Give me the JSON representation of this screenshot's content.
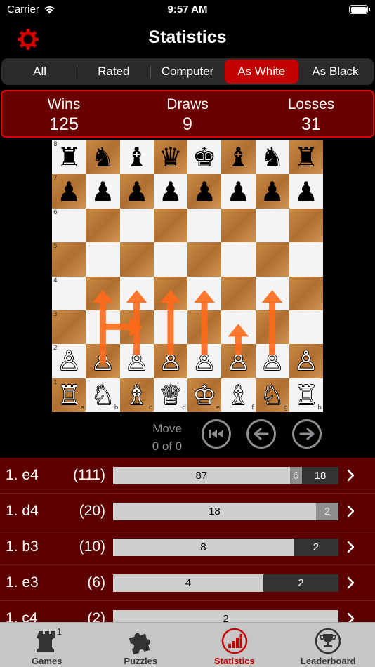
{
  "status": {
    "carrier": "Carrier",
    "time": "9:57 AM"
  },
  "header": {
    "title": "Statistics"
  },
  "segments": [
    {
      "label": "All",
      "active": false
    },
    {
      "label": "Rated",
      "active": false
    },
    {
      "label": "Computer",
      "active": false
    },
    {
      "label": "As White",
      "active": true
    },
    {
      "label": "As Black",
      "active": false
    }
  ],
  "stats": {
    "wins_label": "Wins",
    "wins": "125",
    "draws_label": "Draws",
    "draws": "9",
    "losses_label": "Losses",
    "losses": "31"
  },
  "board": {
    "ranks": [
      [
        "♜",
        "♞",
        "♝",
        "♛",
        "♚",
        "♝",
        "♞",
        "♜"
      ],
      [
        "♟",
        "♟",
        "♟",
        "♟",
        "♟",
        "♟",
        "♟",
        "♟"
      ],
      [
        "",
        "",
        "",
        "",
        "",
        "",
        "",
        ""
      ],
      [
        "",
        "",
        "",
        "",
        "",
        "",
        "",
        ""
      ],
      [
        "",
        "",
        "",
        "",
        "",
        "",
        "",
        ""
      ],
      [
        "",
        "",
        "",
        "",
        "",
        "",
        "",
        ""
      ],
      [
        "♙",
        "♙",
        "♙",
        "♙",
        "♙",
        "♙",
        "♙",
        "♙"
      ],
      [
        "♖",
        "♘",
        "♗",
        "♕",
        "♔",
        "♗",
        "♘",
        "♖"
      ]
    ],
    "rank_labels": [
      "8",
      "7",
      "6",
      "5",
      "4",
      "3",
      "2",
      "1"
    ],
    "file_labels": [
      "a",
      "b",
      "c",
      "d",
      "e",
      "f",
      "g",
      "h"
    ],
    "arrow_color": "#ff6a1a"
  },
  "move": {
    "label": "Move",
    "position": "0 of 0"
  },
  "openings": [
    {
      "move": "1. e4",
      "count": "(111)",
      "wins": 87,
      "draws": 6,
      "losses": 18,
      "wins_label": "87",
      "draws_label": "6",
      "losses_label": "18"
    },
    {
      "move": "1. d4",
      "count": "(20)",
      "wins": 18,
      "draws": 2,
      "losses": 0,
      "wins_label": "18",
      "draws_label": "2",
      "losses_label": ""
    },
    {
      "move": "1. b3",
      "count": "(10)",
      "wins": 8,
      "draws": 0,
      "losses": 2,
      "wins_label": "8",
      "draws_label": "",
      "losses_label": "2"
    },
    {
      "move": "1. e3",
      "count": "(6)",
      "wins": 4,
      "draws": 0,
      "losses": 2,
      "wins_label": "4",
      "draws_label": "",
      "losses_label": "2"
    },
    {
      "move": "1. c4",
      "count": "(2)",
      "wins": 2,
      "draws": 0,
      "losses": 0,
      "wins_label": "2",
      "draws_label": "",
      "losses_label": ""
    }
  ],
  "tabs": [
    {
      "label": "Games",
      "icon": "rook-icon",
      "badge": "1",
      "active": false
    },
    {
      "label": "Puzzles",
      "icon": "puzzle-icon",
      "badge": "",
      "active": false
    },
    {
      "label": "Statistics",
      "icon": "bar-chart-icon",
      "badge": "",
      "active": true
    },
    {
      "label": "Leaderboard",
      "icon": "trophy-icon",
      "badge": "",
      "active": false
    }
  ],
  "colors": {
    "accent": "#c40000",
    "row_bg": "#5c0000",
    "stats_bg": "#6a0000"
  }
}
